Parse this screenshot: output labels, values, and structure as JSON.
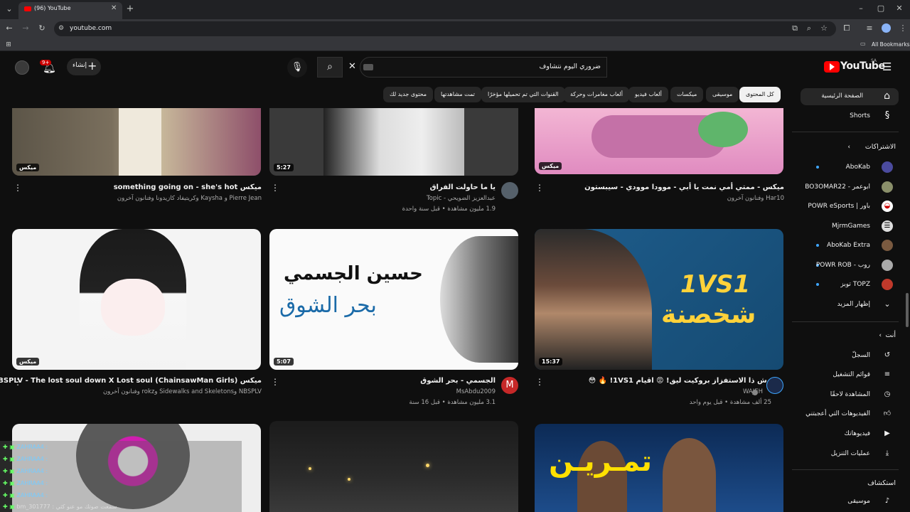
{
  "browser": {
    "tab_title": "(96) YouTube",
    "url": "youtube.com",
    "bookmarks_label": "All Bookmarks"
  },
  "header": {
    "logo_text": "YouTube",
    "region": "SA",
    "search_value": "ضروري اليوم نتشاوف",
    "create_label": "إنشاء",
    "notif_count": "9+"
  },
  "chips": [
    "كل المحتوى",
    "موسيقى",
    "ميكسات",
    "ألعاب فيديو",
    "ألعاب مغامرات وحركة",
    "القنوات التي تم تحميلها مؤخرًا",
    "تمت مشاهدتها",
    "محتوى جديد لك"
  ],
  "sidebar": {
    "home": "الصفحة الرئيسية",
    "shorts": "Shorts",
    "subs_title": "الاشتراكات",
    "subs": [
      "AboKab",
      "ابوعمر - BO3OMAR22",
      "باور | POWR eSports",
      "MjrmGames",
      "AboKab Extra",
      "روب - POWR ROB",
      "TOPZ توبز"
    ],
    "show_more": "إظهار المزيد",
    "you_title": "أنت",
    "you_items": [
      "السجلّ",
      "قوائم التشغيل",
      "المشاهدة لاحقًا",
      "الفيديوهات التي أعجبتني",
      "فيديوهاتك",
      "عمليات التنزيل"
    ],
    "explore_title": "استكشاف",
    "explore_items": [
      "موسيقى"
    ]
  },
  "videos": {
    "r1c1": {
      "badge": "ميكس",
      "title": "ميكس something going on - she's hot",
      "meta1": "Pierre Jean و Kaysha وكريتيفاد كازيدونا وفنانون آخرون"
    },
    "r1c2": {
      "duration": "5:27",
      "title": "يا ما حاولت الفراق",
      "meta1": "عبدالعزيز الضويحي - Topic",
      "meta2": "1.9 مليون مشاهدة • قبل سنة واحدة"
    },
    "r1c3": {
      "badge": "ميكس",
      "title": "ميكس - ممتي أمي نمت يا أبي - موودا موودي - سيبستون",
      "meta1": "Har10 وفنانون آخرون"
    },
    "r2c1": {
      "badge": "ميكس",
      "title": "ميكس NBSPLV - The lost soul down X Lost soul (ChainsawMan Girls)",
      "meta1": "NBSPLV وSidewalks and Skeletons وrokz وفنانون آخرون"
    },
    "r2c2": {
      "duration": "5:07",
      "title": "الجسمي - بحر الشوق",
      "meta1": "MsAbdu2009",
      "meta2": "3.1 مليون مشاهدة • قبل 16 سنة",
      "avatar_letter": "M",
      "thumb_text1": "حسين الجسمي",
      "thumb_text2": "بحر الشوق"
    },
    "r2c3": {
      "duration": "15:37",
      "title": "وش ذا الاستفزاز بروكيت ليق! 😡 اقيام 1VS1! 🔥 😳",
      "meta1": "WAJEH",
      "meta2": "25 ألف مشاهدة • قبل يوم واحد",
      "thumb_text1": "1VS1",
      "thumb_text2": "شخصنة"
    },
    "r3c3": {
      "thumb_text1": "تمـريـن"
    }
  },
  "overlay_chat": {
    "rows": [
      "ZAHRAA4 :",
      "ZAHRAA4 :",
      "ZAHRAA4 :",
      "ZAHRAA4 :",
      "ZAHRAA4 :"
    ],
    "last": "bm_301777 : سمعت صوتك مو عنو كثي"
  },
  "colors": {
    "bg": "#0f0f0f",
    "chip": "#272727",
    "accent_red": "#ff0000",
    "link_blue": "#3ea6ff"
  }
}
